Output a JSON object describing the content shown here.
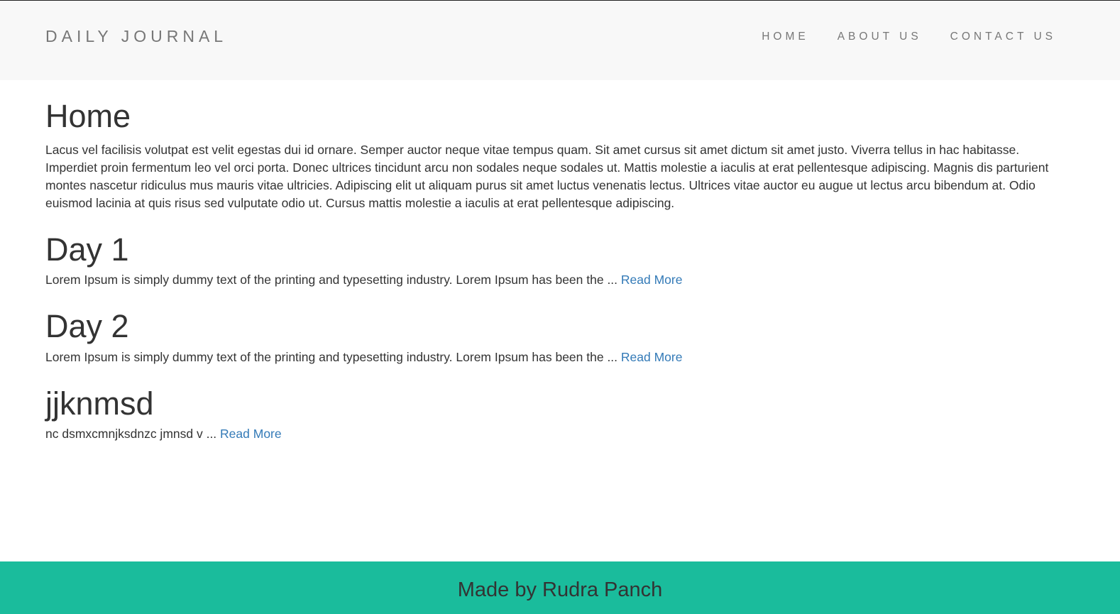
{
  "navbar": {
    "brand": "DAILY JOURNAL",
    "links": [
      {
        "label": "HOME"
      },
      {
        "label": "ABOUT US"
      },
      {
        "label": "CONTACT US"
      }
    ]
  },
  "main": {
    "heading": "Home",
    "intro": "Lacus vel facilisis volutpat est velit egestas dui id ornare. Semper auctor neque vitae tempus quam. Sit amet cursus sit amet dictum sit amet justo. Viverra tellus in hac habitasse. Imperdiet proin fermentum leo vel orci porta. Donec ultrices tincidunt arcu non sodales neque sodales ut. Mattis molestie a iaculis at erat pellentesque adipiscing. Magnis dis parturient montes nascetur ridiculus mus mauris vitae ultricies. Adipiscing elit ut aliquam purus sit amet luctus venenatis lectus. Ultrices vitae auctor eu augue ut lectus arcu bibendum at. Odio euismod lacinia at quis risus sed vulputate odio ut. Cursus mattis molestie a iaculis at erat pellentesque adipiscing.",
    "posts": [
      {
        "title": "Day 1",
        "excerpt": "Lorem Ipsum is simply dummy text of the printing and typesetting industry. Lorem Ipsum has been the ... ",
        "read_more": "Read More"
      },
      {
        "title": "Day 2",
        "excerpt": "Lorem Ipsum is simply dummy text of the printing and typesetting industry. Lorem Ipsum has been the ... ",
        "read_more": "Read More"
      },
      {
        "title": "jjknmsd",
        "excerpt": "nc dsmxcmnjksdnzc jmnsd v ... ",
        "read_more": "Read More"
      }
    ]
  },
  "footer": {
    "text": "Made by Rudra Panch"
  },
  "colors": {
    "navbar_bg": "#f8f8f8",
    "link_color": "#337ab7",
    "footer_bg": "#1abc9c",
    "text": "#333333",
    "nav_text": "#777777"
  }
}
